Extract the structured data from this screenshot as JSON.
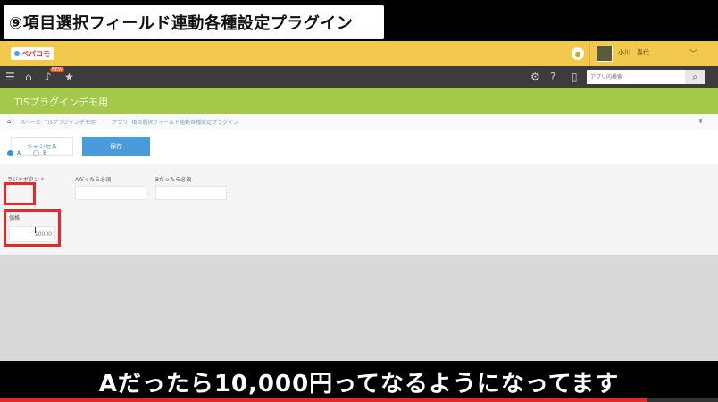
{
  "video": {
    "title": "⑨項目選択フィールド連動各種設定プラグイン",
    "subtitle": "Aだったら10,000円ってなるようになってます",
    "progress": 0.9
  },
  "header": {
    "logo_text": "ペパコモ",
    "username": "小川　喜代",
    "chevron": "﹀"
  },
  "nav": {
    "badge": "NEW",
    "search_placeholder": "アプリ内検索"
  },
  "space": {
    "title": "TISプラグインデモ用"
  },
  "breadcrumb": {
    "items": [
      "スペース: TISプラグインデモ用",
      "アプリ: 項目選択フィールド連動各種設定プラグイン"
    ],
    "separator": "›"
  },
  "toolbar": {
    "cancel_label": "キャンセル",
    "save_label": "保存"
  },
  "form": {
    "radio_label": "ラジオボタン",
    "required_mark": "*",
    "radio_options": [
      "A",
      "B"
    ],
    "selected_option": "A",
    "field_a_label": "Aだったら必須",
    "field_b_label": "Bだったら必須",
    "price_label": "価格",
    "price_value": "10000"
  },
  "colors": {
    "header_yellow": "#f2c94c",
    "space_green": "#a4c94a",
    "save_blue": "#4b9ad9",
    "highlight_red": "#e32a2a"
  }
}
